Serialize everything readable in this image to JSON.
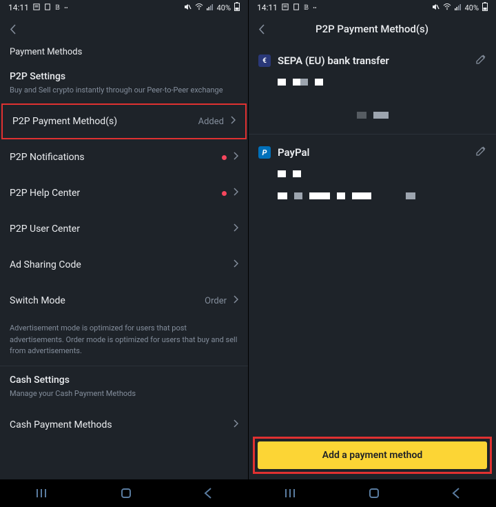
{
  "status": {
    "time": "14:11",
    "battery": "40%"
  },
  "left": {
    "header": "Payment Methods",
    "p2pSettings": {
      "title": "P2P Settings",
      "desc": "Buy and Sell crypto instantly through our Peer-to-Peer exchange"
    },
    "items": [
      {
        "label": "P2P Payment Method(s)",
        "right": "Added",
        "dot": false,
        "highlight": true
      },
      {
        "label": "P2P Notifications",
        "right": "",
        "dot": true
      },
      {
        "label": "P2P Help Center",
        "right": "",
        "dot": true
      },
      {
        "label": "P2P User Center",
        "right": "",
        "dot": false
      },
      {
        "label": "Ad Sharing Code",
        "right": "",
        "dot": false
      },
      {
        "label": "Switch Mode",
        "right": "Order",
        "dot": false
      }
    ],
    "modeDesc": "Advertisement mode is optimized for users that post advertisements. Order mode is optimized for users that buy and sell from advertisements.",
    "cashSettings": {
      "title": "Cash Settings",
      "desc": "Manage your Cash Payment Methods"
    },
    "cashItem": "Cash Payment Methods"
  },
  "right": {
    "title": "P2P Payment Method(s)",
    "methods": [
      {
        "name": "SEPA (EU) bank transfer",
        "logo": "sepa"
      },
      {
        "name": "PayPal",
        "logo": "paypal"
      }
    ],
    "addButton": "Add a payment method",
    "paypalLetter": "P"
  }
}
